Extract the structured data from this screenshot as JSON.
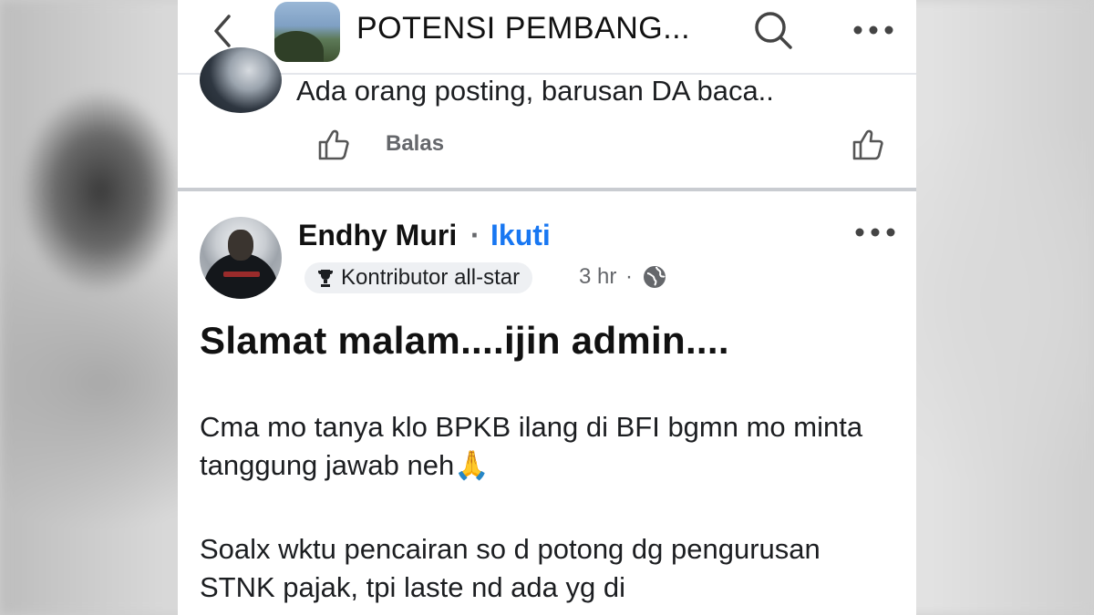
{
  "header": {
    "title": "POTENSI PEMBANG..."
  },
  "previous_comment": {
    "text": "Ada orang posting, barusan DA baca..",
    "reply_label": "Balas"
  },
  "post": {
    "author": "Endhy Muri",
    "separator": "·",
    "follow_label": "Ikuti",
    "badge": "Kontributor all-star",
    "time": "3 hr",
    "time_separator": "·",
    "heading": "Slamat malam....ijin admin....",
    "paragraph1": "Cma mo tanya klo BPKB ilang di BFI bgmn mo minta tanggung jawab neh🙏",
    "paragraph2": "Soalx wktu pencairan so d potong dg pengurusan STNK pajak, tpi laste nd ada yg di"
  },
  "colors": {
    "accent": "#1877f2",
    "secondary_text": "#65676b",
    "badge_bg": "#eef0f3",
    "separator": "#c9ccd1"
  },
  "icons": [
    "chevron-left-icon",
    "search-icon",
    "more-horizontal-icon",
    "thumbs-up-icon",
    "trophy-icon",
    "globe-icon"
  ]
}
